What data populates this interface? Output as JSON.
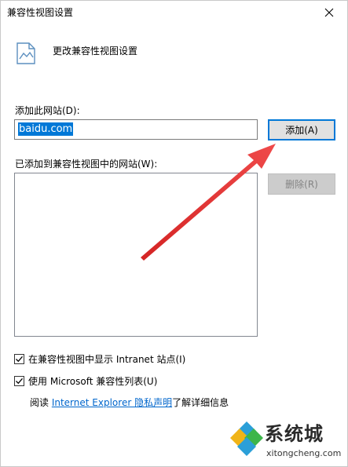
{
  "window": {
    "title": "兼容性视图设置",
    "close_glyph": "✕"
  },
  "header": {
    "text": "更改兼容性视图设置",
    "icon": "page-settings-icon"
  },
  "add_site": {
    "label": "添加此网站(D):",
    "value": "baidu.com",
    "add_button": "添加(A)"
  },
  "site_list": {
    "label": "已添加到兼容性视图中的网站(W):",
    "items": [],
    "remove_button": "删除(R)"
  },
  "options": {
    "show_intranet": {
      "label": "在兼容性视图中显示 Intranet 站点(I)",
      "checked": true
    },
    "use_ms_list": {
      "label": "使用 Microsoft 兼容性列表(U)",
      "checked": true
    }
  },
  "privacy": {
    "prefix": "阅读 ",
    "link": "Internet Explorer 隐私声明",
    "suffix": "了解详细信息"
  },
  "watermark": {
    "brand": "系统城",
    "url": "xitongcheng.com"
  },
  "colors": {
    "accent": "#0078d7",
    "arrow": "#e53333",
    "link": "#0066cc"
  }
}
